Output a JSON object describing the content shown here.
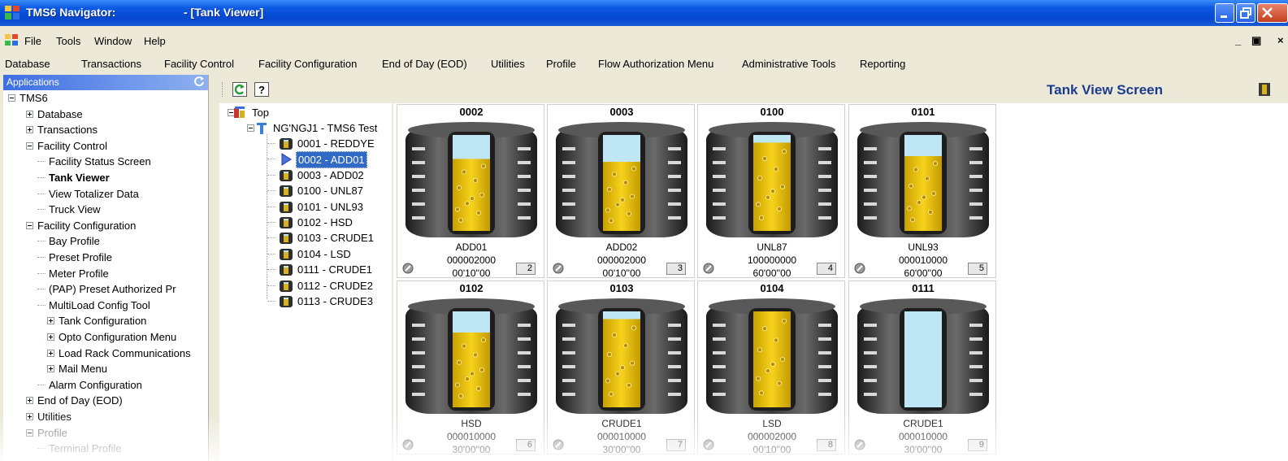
{
  "window": {
    "app_title": "TMS6 Navigator:",
    "doc_title": "- [Tank Viewer]"
  },
  "menu_top": [
    "File",
    "Tools",
    "Window",
    "Help"
  ],
  "menu_main": [
    "Database",
    "Transactions",
    "Facility Control",
    "Facility Configuration",
    "End of Day (EOD)",
    "Utilities",
    "Profile",
    "Flow Authorization Menu",
    "Administrative Tools",
    "Reporting"
  ],
  "left_panel": {
    "header": "Applications",
    "tree": [
      {
        "label": "TMS6",
        "level": 0,
        "expander": "minus"
      },
      {
        "label": "Database",
        "level": 1,
        "expander": "plus"
      },
      {
        "label": "Transactions",
        "level": 1,
        "expander": "plus"
      },
      {
        "label": "Facility Control",
        "level": 1,
        "expander": "minus"
      },
      {
        "label": "Facility Status Screen",
        "level": 2,
        "expander": ""
      },
      {
        "label": "Tank Viewer",
        "level": 2,
        "expander": "",
        "selected": true
      },
      {
        "label": "View Totalizer Data",
        "level": 2,
        "expander": ""
      },
      {
        "label": "Truck View",
        "level": 2,
        "expander": ""
      },
      {
        "label": "Facility Configuration",
        "level": 1,
        "expander": "minus"
      },
      {
        "label": "Bay Profile",
        "level": 2,
        "expander": ""
      },
      {
        "label": "Preset Profile",
        "level": 2,
        "expander": ""
      },
      {
        "label": "Meter Profile",
        "level": 2,
        "expander": ""
      },
      {
        "label": "(PAP) Preset Authorized Pr",
        "level": 2,
        "expander": ""
      },
      {
        "label": "MultiLoad Config Tool",
        "level": 2,
        "expander": ""
      },
      {
        "label": "Tank Configuration",
        "level": 2,
        "expander": "plus"
      },
      {
        "label": "Opto Configuration Menu",
        "level": 2,
        "expander": "plus"
      },
      {
        "label": "Load Rack Communications",
        "level": 2,
        "expander": "plus"
      },
      {
        "label": "Mail Menu",
        "level": 2,
        "expander": "plus"
      },
      {
        "label": "Alarm Configuration",
        "level": 2,
        "expander": ""
      },
      {
        "label": "End of Day (EOD)",
        "level": 1,
        "expander": "plus"
      },
      {
        "label": "Utilities",
        "level": 1,
        "expander": "plus"
      },
      {
        "label": "Profile",
        "level": 1,
        "expander": "minus"
      },
      {
        "label": "Terminal Profile",
        "level": 2,
        "expander": ""
      }
    ]
  },
  "screen_title": "Tank View Screen",
  "tank_tree": {
    "root": "Top",
    "facility": "NG'NGJ1 - TMS6 Test",
    "tanks": [
      "0001 - REDDYE",
      "0002 - ADD01",
      "0003 - ADD02",
      "0100 - UNL87",
      "0101 - UNL93",
      "0102 - HSD",
      "0103 - CRUDE1",
      "0104 - LSD",
      "0111 - CRUDE1",
      "0112 - CRUDE2",
      "0113 - CRUDE3"
    ],
    "selected_index": 1
  },
  "tanks": [
    {
      "id": "0002",
      "product": "ADD01",
      "volume": "000002000",
      "time": "00'10''00",
      "num": "2",
      "fill": 0.75
    },
    {
      "id": "0003",
      "product": "ADD02",
      "volume": "000002000",
      "time": "00'10''00",
      "num": "3",
      "fill": 0.72
    },
    {
      "id": "0100",
      "product": "UNL87",
      "volume": "100000000",
      "time": "60'00''00",
      "num": "4",
      "fill": 0.92
    },
    {
      "id": "0101",
      "product": "UNL93",
      "volume": "000010000",
      "time": "60'00''00",
      "num": "5",
      "fill": 0.78
    },
    {
      "id": "0102",
      "product": "HSD",
      "volume": "000010000",
      "time": "30'00''00",
      "num": "6",
      "fill": 0.78
    },
    {
      "id": "0103",
      "product": "CRUDE1",
      "volume": "000010000",
      "time": "30'00''00",
      "num": "7",
      "fill": 0.92
    },
    {
      "id": "0104",
      "product": "LSD",
      "volume": "000002000",
      "time": "00'10''00",
      "num": "8",
      "fill": 1.0
    },
    {
      "id": "0111",
      "product": "CRUDE1",
      "volume": "000010000",
      "time": "30'00''00",
      "num": "9",
      "fill": 0.0
    }
  ]
}
